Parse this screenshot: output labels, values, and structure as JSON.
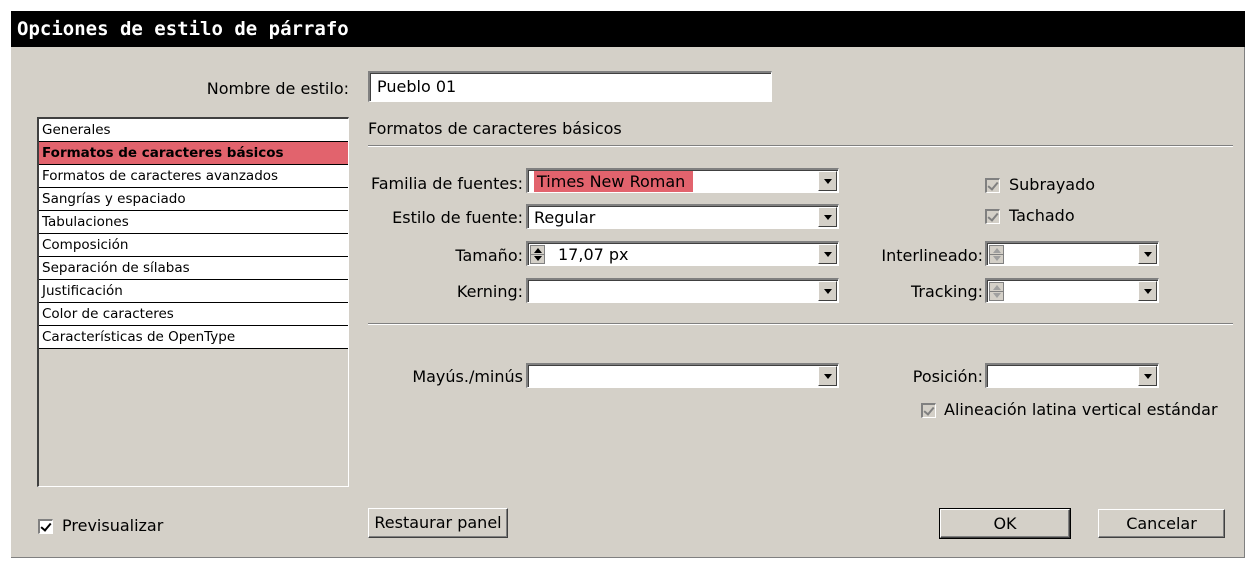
{
  "window": {
    "title": "Opciones de estilo de párrafo"
  },
  "style_name": {
    "label": "Nombre de estilo:",
    "value": "Pueblo 01"
  },
  "sidebar": {
    "items": [
      {
        "label": "Generales",
        "selected": false
      },
      {
        "label": "Formatos de caracteres básicos",
        "selected": true
      },
      {
        "label": "Formatos de caracteres avanzados",
        "selected": false
      },
      {
        "label": "Sangrías y espaciado",
        "selected": false
      },
      {
        "label": "Tabulaciones",
        "selected": false
      },
      {
        "label": "Composición",
        "selected": false
      },
      {
        "label": "Separación de sílabas",
        "selected": false
      },
      {
        "label": "Justificación",
        "selected": false
      },
      {
        "label": "Color de caracteres",
        "selected": false
      },
      {
        "label": "Características de OpenType",
        "selected": false
      }
    ]
  },
  "panel": {
    "heading": "Formatos de caracteres básicos",
    "font_family": {
      "label": "Familia de fuentes:",
      "value": "Times New Roman"
    },
    "font_style": {
      "label": "Estilo de fuente:",
      "value": "Regular"
    },
    "size": {
      "label": "Tamaño:",
      "value": "17,07 px"
    },
    "kerning": {
      "label": "Kerning:",
      "value": ""
    },
    "underline": {
      "label": "Subrayado",
      "checked": true
    },
    "strikethrough": {
      "label": "Tachado",
      "checked": true
    },
    "leading": {
      "label": "Interlineado:",
      "value": ""
    },
    "tracking": {
      "label": "Tracking:",
      "value": ""
    },
    "case": {
      "label": "Mayús./minús",
      "value": ""
    },
    "position": {
      "label": "Posición:",
      "value": ""
    },
    "roman_vertical": {
      "label": "Alineación latina vertical estándar",
      "checked": true
    }
  },
  "footer": {
    "preview": {
      "label": "Previsualizar",
      "checked": true
    },
    "reset_label": "Restaurar panel",
    "ok_label": "OK",
    "cancel_label": "Cancelar"
  },
  "colors": {
    "highlight": "#e2636d",
    "dialog_bg": "#d4d0c8",
    "titlebar": "#000000"
  }
}
